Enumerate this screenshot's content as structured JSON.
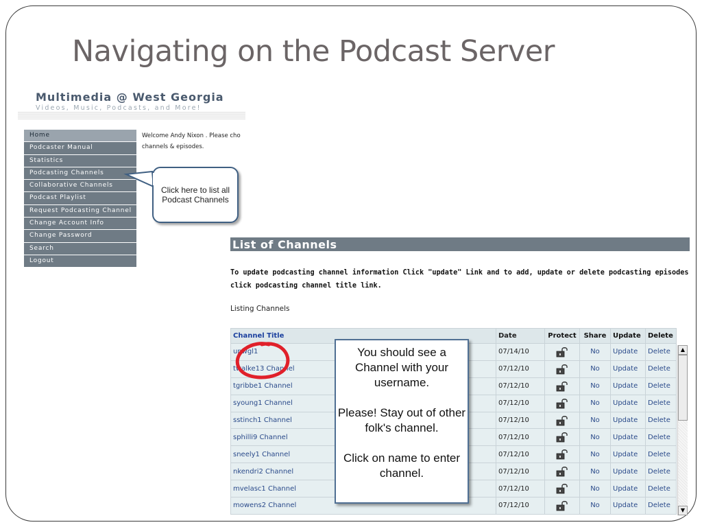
{
  "slide": {
    "title": "Navigating on the Podcast Server"
  },
  "banner": {
    "title": "Multimedia @ West Georgia",
    "subtitle": "Videos, Music, Podcasts, and More!"
  },
  "nav": {
    "items": [
      "Home",
      "Podcaster Manual",
      "Statistics",
      "Podcasting Channels",
      "Collaborative Channels",
      "Podcast Playlist",
      "Request Podcasting Channel",
      "Change Account Info",
      "Change Password",
      "Search",
      "Logout"
    ]
  },
  "welcome": {
    "line1": "Welcome Andy Nixon . Please cho",
    "line2": "channels & episodes."
  },
  "callout1": {
    "text": "Click here to list all Podcast Channels"
  },
  "list": {
    "header": "List of Channels",
    "instructions": "To update podcasting channel information Click \"update\" Link and to add, update or delete podcasting episodes click podcasting channel title link.",
    "listing_label": "Listing Channels"
  },
  "table": {
    "headers": {
      "title": "Channel Title",
      "date": "Date",
      "protect": "Protect",
      "share": "Share",
      "update": "Update",
      "delete": "Delete"
    },
    "rows": [
      {
        "title": "upwgl1",
        "date": "07/14/10",
        "share": "No",
        "update": "Update",
        "delete": "Delete"
      },
      {
        "title": "twalke13 Channel",
        "date": "07/12/10",
        "share": "No",
        "update": "Update",
        "delete": "Delete"
      },
      {
        "title": "tgribbe1 Channel",
        "date": "07/12/10",
        "share": "No",
        "update": "Update",
        "delete": "Delete"
      },
      {
        "title": "syoung1 Channel",
        "date": "07/12/10",
        "share": "No",
        "update": "Update",
        "delete": "Delete"
      },
      {
        "title": "sstinch1 Channel",
        "date": "07/12/10",
        "share": "No",
        "update": "Update",
        "delete": "Delete"
      },
      {
        "title": "sphilli9 Channel",
        "date": "07/12/10",
        "share": "No",
        "update": "Update",
        "delete": "Delete"
      },
      {
        "title": "sneely1 Channel",
        "date": "07/12/10",
        "share": "No",
        "update": "Update",
        "delete": "Delete"
      },
      {
        "title": "nkendri2 Channel",
        "date": "07/12/10",
        "share": "No",
        "update": "Update",
        "delete": "Delete"
      },
      {
        "title": "mvelasc1 Channel",
        "date": "07/12/10",
        "share": "No",
        "update": "Update",
        "delete": "Delete"
      },
      {
        "title": "mowens2 Channel",
        "date": "07/12/10",
        "share": "No",
        "update": "Update",
        "delete": "Delete"
      }
    ]
  },
  "callout2": {
    "line1": "You should see a Channel with your username.",
    "line2": "Please! Stay out of other folk's channel.",
    "line3": "Click on name to enter channel."
  },
  "colors": {
    "nav_bg": "#6f7b85",
    "nav_active": "#9aa4ad",
    "title": "#6b6566",
    "callout_border": "#3f5f82",
    "highlight": "#e0202a",
    "link": "#2a4a8a"
  },
  "icons": {
    "lock": "unlocked-padlock-icon",
    "scroll_up": "scroll-up-arrow-icon",
    "scroll_down": "scroll-down-arrow-icon"
  }
}
